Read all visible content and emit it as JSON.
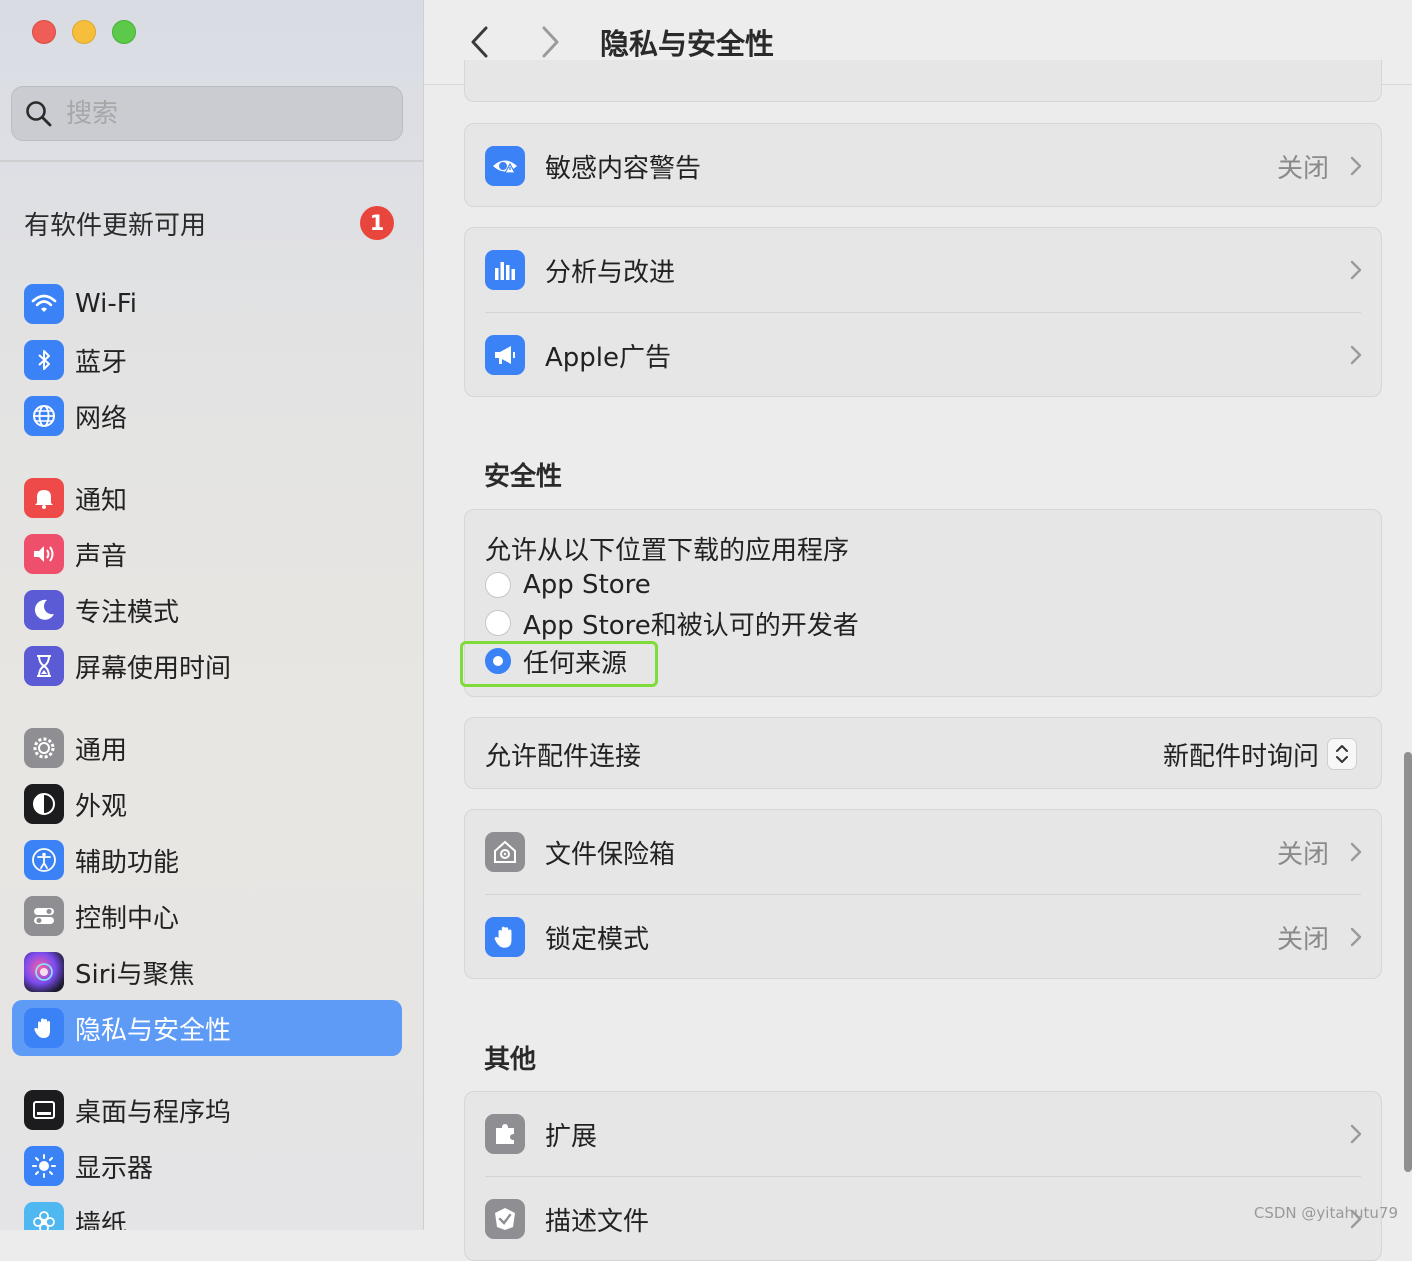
{
  "window": {
    "title": "隐私与安全性"
  },
  "search": {
    "placeholder": "搜索"
  },
  "sidebar": {
    "update": {
      "label": "有软件更新可用",
      "count": "1"
    },
    "items": [
      {
        "label": "Wi-Fi",
        "icon": "wifi-icon"
      },
      {
        "label": "蓝牙",
        "icon": "bluetooth-icon"
      },
      {
        "label": "网络",
        "icon": "globe-icon"
      },
      {
        "label": "通知",
        "icon": "bell-icon"
      },
      {
        "label": "声音",
        "icon": "speaker-icon"
      },
      {
        "label": "专注模式",
        "icon": "moon-icon"
      },
      {
        "label": "屏幕使用时间",
        "icon": "hourglass-icon"
      },
      {
        "label": "通用",
        "icon": "gear-icon"
      },
      {
        "label": "外观",
        "icon": "appearance-icon"
      },
      {
        "label": "辅助功能",
        "icon": "accessibility-icon"
      },
      {
        "label": "控制中心",
        "icon": "toggles-icon"
      },
      {
        "label": "Siri与聚焦",
        "icon": "siri-icon"
      },
      {
        "label": "隐私与安全性",
        "icon": "hand-icon",
        "active": true
      },
      {
        "label": "桌面与程序坞",
        "icon": "dock-icon"
      },
      {
        "label": "显示器",
        "icon": "sun-icon"
      },
      {
        "label": "墙纸",
        "icon": "flower-icon"
      }
    ]
  },
  "main": {
    "sensitive": {
      "label": "敏感内容警告",
      "value": "关闭"
    },
    "analytics": {
      "label": "分析与改进"
    },
    "ads": {
      "label": "Apple广告"
    },
    "security": {
      "heading": "安全性",
      "downloads_label": "允许从以下位置下载的应用程序",
      "options": [
        "App Store",
        "App Store和被认可的开发者",
        "任何来源"
      ],
      "selected": "任何来源"
    },
    "accessories": {
      "label": "允许配件连接",
      "value": "新配件时询问"
    },
    "filevault": {
      "label": "文件保险箱",
      "value": "关闭"
    },
    "lockdown": {
      "label": "锁定模式",
      "value": "关闭"
    },
    "others": {
      "heading": "其他",
      "extensions": {
        "label": "扩展"
      },
      "profiles": {
        "label": "描述文件"
      }
    }
  },
  "watermark": "CSDN @yitahutu79",
  "colors": {
    "accent": "#3b82f6",
    "sidebar_active": "#5e9bf6",
    "badge": "#e8463c",
    "highlight": "#7ddc3a"
  }
}
